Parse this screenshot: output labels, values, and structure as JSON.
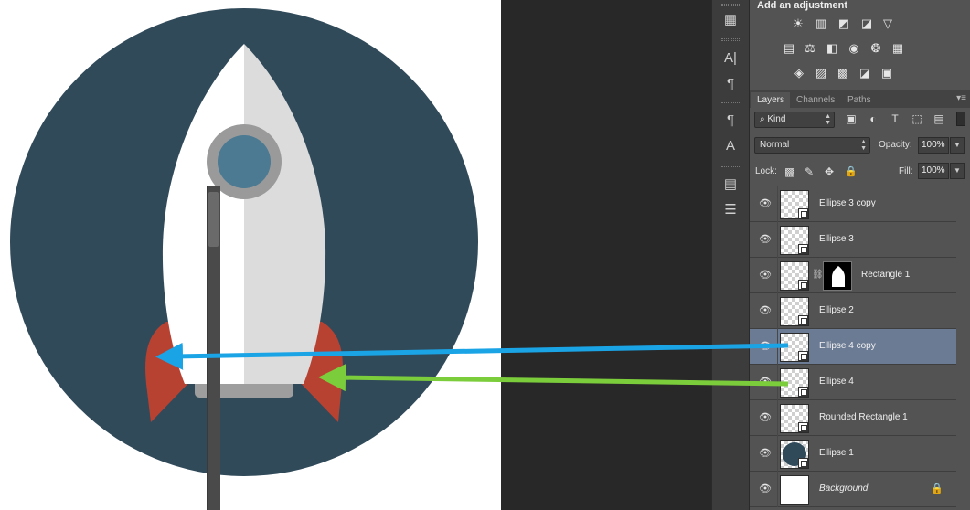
{
  "canvas": {
    "colors": {
      "circle": "#304a5a",
      "body_light": "#ffffff",
      "body_shade": "#dcdcdc",
      "window_ring": "#9a9a9a",
      "window_glass": "#4b7a92",
      "fins": "#b84232",
      "nozzle": "#9e9e9e"
    }
  },
  "tool_strip": {
    "items": [
      {
        "icon": "layer-comps-icon",
        "glyph": "▦"
      },
      {
        "icon": "character-icon",
        "glyph": "A|"
      },
      {
        "icon": "paragraph-icon",
        "glyph": "¶"
      },
      {
        "icon": "paragraph-styles-icon",
        "glyph": "¶"
      },
      {
        "icon": "character-styles-icon",
        "glyph": "A"
      },
      {
        "icon": "notes-icon",
        "glyph": "▤"
      },
      {
        "icon": "properties-icon",
        "glyph": "☰"
      }
    ]
  },
  "adjustments": {
    "title": "Add an adjustment",
    "row1": [
      "☀",
      "▥",
      "◩",
      "◪",
      "▽"
    ],
    "row2": [
      "▤",
      "⚖",
      "◧",
      "◉",
      "❂",
      "▦"
    ],
    "row3": [
      "◈",
      "▨",
      "▩",
      "◪",
      "▣"
    ]
  },
  "tabs": [
    {
      "label": "Layers",
      "active": true
    },
    {
      "label": "Channels",
      "active": false
    },
    {
      "label": "Paths",
      "active": false
    }
  ],
  "panel_menu_glyph": "▾≡",
  "filter": {
    "kind_label": "Kind",
    "search_glyph": "⌕",
    "icons": [
      "▣",
      "◐",
      "T",
      "⬚",
      "▤"
    ]
  },
  "blend": {
    "mode": "Normal",
    "opacity_label": "Opacity:",
    "opacity_value": "100%"
  },
  "lock": {
    "label": "Lock:",
    "icons": [
      "▩",
      "✎",
      "✥",
      "🔒"
    ],
    "fill_label": "Fill:",
    "fill_value": "100%"
  },
  "layers": [
    {
      "name": "Ellipse 3 copy",
      "type": "shape",
      "selected": false
    },
    {
      "name": "Ellipse 3",
      "type": "shape",
      "selected": false
    },
    {
      "name": "Rectangle 1",
      "type": "masked",
      "selected": false
    },
    {
      "name": "Ellipse 2",
      "type": "shape",
      "selected": false
    },
    {
      "name": "Ellipse 4 copy",
      "type": "shape",
      "selected": true
    },
    {
      "name": "Ellipse 4",
      "type": "shape",
      "selected": false
    },
    {
      "name": "Rounded Rectangle 1",
      "type": "shape",
      "selected": false
    },
    {
      "name": "Ellipse 1",
      "type": "shape",
      "selected": false
    },
    {
      "name": "Background",
      "type": "background",
      "selected": false
    }
  ],
  "eye_glyph": "👁",
  "chain_glyph": "⛓",
  "lock_glyph": "🔒",
  "annotations": {
    "blue_arrow_color": "#1aa4e6",
    "green_arrow_color": "#7ccd3c"
  }
}
